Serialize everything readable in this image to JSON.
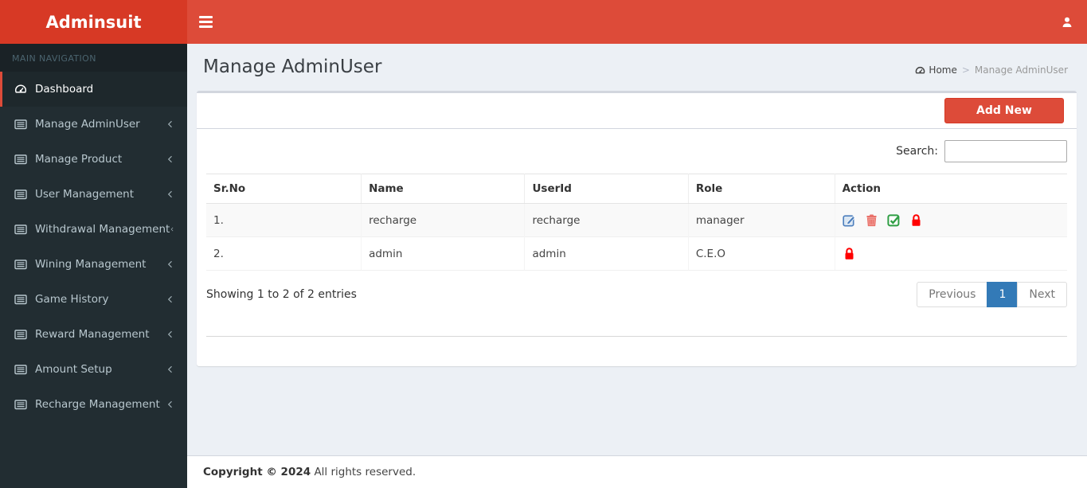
{
  "header": {
    "brand": "Adminsuit"
  },
  "sidebar": {
    "section_label": "MAIN NAVIGATION",
    "items": [
      {
        "label": "Dashboard",
        "icon": "tachometer",
        "active": true,
        "has_submenu": false
      },
      {
        "label": "Manage AdminUser",
        "icon": "list",
        "active": false,
        "has_submenu": true
      },
      {
        "label": "Manage Product",
        "icon": "list",
        "active": false,
        "has_submenu": true
      },
      {
        "label": "User Management",
        "icon": "list",
        "active": false,
        "has_submenu": true
      },
      {
        "label": "Withdrawal Management",
        "icon": "list",
        "active": false,
        "has_submenu": true
      },
      {
        "label": "Wining Management",
        "icon": "list",
        "active": false,
        "has_submenu": true
      },
      {
        "label": "Game History",
        "icon": "list",
        "active": false,
        "has_submenu": true
      },
      {
        "label": "Reward Management",
        "icon": "list",
        "active": false,
        "has_submenu": true
      },
      {
        "label": "Amount Setup",
        "icon": "list",
        "active": false,
        "has_submenu": true
      },
      {
        "label": "Recharge Management",
        "icon": "list",
        "active": false,
        "has_submenu": true
      }
    ]
  },
  "content": {
    "page_title": "Manage AdminUser",
    "breadcrumb": {
      "home": "Home",
      "separator": ">",
      "current": "Manage AdminUser"
    },
    "add_new_label": "Add New",
    "search": {
      "label": "Search:",
      "value": ""
    },
    "table": {
      "columns": [
        "Sr.No",
        "Name",
        "UserId",
        "Role",
        "Action"
      ],
      "rows": [
        {
          "sr": "1.",
          "name": "recharge",
          "userid": "recharge",
          "role": "manager",
          "actions": [
            "edit",
            "delete",
            "approve",
            "lock"
          ]
        },
        {
          "sr": "2.",
          "name": "admin",
          "userid": "admin",
          "role": "C.E.O",
          "actions": [
            "lock"
          ]
        }
      ]
    },
    "info_text": "Showing 1 to 2 of 2 entries",
    "pagination": {
      "previous": "Previous",
      "current": "1",
      "next": "Next"
    }
  },
  "footer": {
    "bold_text": "Copyright © 2024",
    "text": "All rights reserved."
  },
  "colors": {
    "brand_bg": "#d73925",
    "navbar_bg": "#dd4b39",
    "sidebar_bg": "#222d32",
    "sidebar_active_bg": "#1e282c",
    "sidebar_active_border": "#dd4b39",
    "content_bg": "#ecf0f5",
    "add_button_bg": "#dd4b39",
    "pagination_active_bg": "#337ab7",
    "icon_edit": "#4d7fbd",
    "icon_delete": "#e97069",
    "icon_approve": "#2f9e44",
    "icon_lock": "#ff0000"
  }
}
